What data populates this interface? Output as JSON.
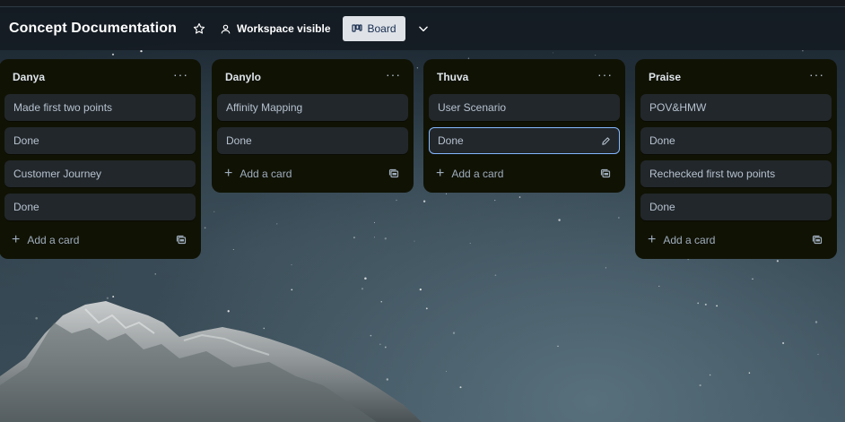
{
  "header": {
    "board_title": "Concept Documentation",
    "visibility_label": "Workspace visible",
    "view_label": "Board",
    "icons": {
      "star": "star-icon",
      "visibility": "people-icon",
      "view": "board-icon",
      "chevron": "chevron-down-icon"
    }
  },
  "lists": [
    {
      "title": "Danya",
      "cards": [
        "Made first two points",
        "Done",
        "Customer Journey",
        "Done"
      ],
      "add_label": "Add a card"
    },
    {
      "title": "Danylo",
      "cards": [
        "Affinity Mapping",
        "Done"
      ],
      "add_label": "Add a card"
    },
    {
      "title": "Thuva",
      "cards": [
        "User Scenario",
        "Done"
      ],
      "focused_card": "Done",
      "add_label": "Add a card"
    },
    {
      "title": "Praise",
      "cards": [
        "POV&HMW",
        "Done",
        "Rechecked first two points",
        "Done"
      ],
      "add_label": "Add a card"
    }
  ],
  "list_menu_label": "···",
  "colors": {
    "list_bg": "#101204",
    "card_bg": "#22272b",
    "focus_outline": "#85b8ff",
    "view_button_bg": "#dfe3e8"
  }
}
